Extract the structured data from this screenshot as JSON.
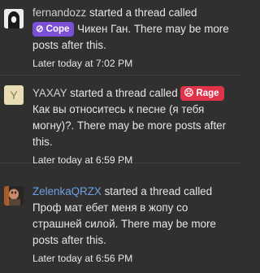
{
  "notifications": [
    {
      "username": "fernandozz",
      "action": " started a thread called ",
      "prefix_badge": {
        "icon": "⊘",
        "label": "Cope",
        "color": "#7b4fd6",
        "icon_name": "cope-icon"
      },
      "thread_title": " Чикен Ган.",
      "suffix": " There may be more posts after this.",
      "time": "Later today at 7:02 PM"
    },
    {
      "username": "YAXAY",
      "action": " started a thread called ",
      "prefix_badge": {
        "icon": "☹",
        "label": "Rage",
        "color": "#e0334a",
        "icon_name": "rage-icon"
      },
      "thread_title": " Как вы относитесь к песне (я тебя могну)?.",
      "suffix": " There may be more posts after this.",
      "time": "Later today at 6:59 PM",
      "avatar_letter": "Y"
    },
    {
      "username": "ZelenkaQRZX",
      "action": " started a thread called ",
      "thread_title": "Проф мат ебет меня в жопу со страшней силой.",
      "suffix": " There may be more posts after this.",
      "time": "Later today at 6:56 PM"
    }
  ]
}
